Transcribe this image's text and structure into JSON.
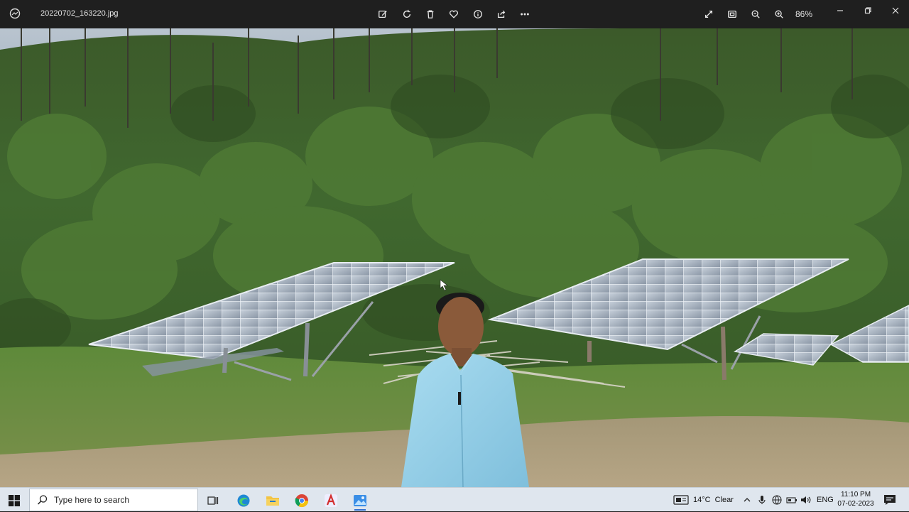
{
  "window": {
    "filename": "20220702_163220.jpg",
    "zoom_level": "86%"
  },
  "toolbar": {
    "icons": [
      "edit-image-icon",
      "rotate-icon",
      "delete-icon",
      "favorite-heart-icon",
      "info-icon",
      "share-icon",
      "more-options-icon"
    ],
    "right_icons": [
      "fullscreen-icon",
      "fit-screen-icon",
      "zoom-out-icon",
      "zoom-in-icon"
    ]
  },
  "taskbar": {
    "search_placeholder": "Type here to search",
    "weather_temp": "14°C",
    "weather_condition": "Clear",
    "language": "ENG",
    "time": "11:10 PM",
    "date": "07-02-2023"
  },
  "colors": {
    "titlebar": "#1f1f1f",
    "taskbar": "#dfe6ee",
    "shirt": "#9fd3ea"
  }
}
